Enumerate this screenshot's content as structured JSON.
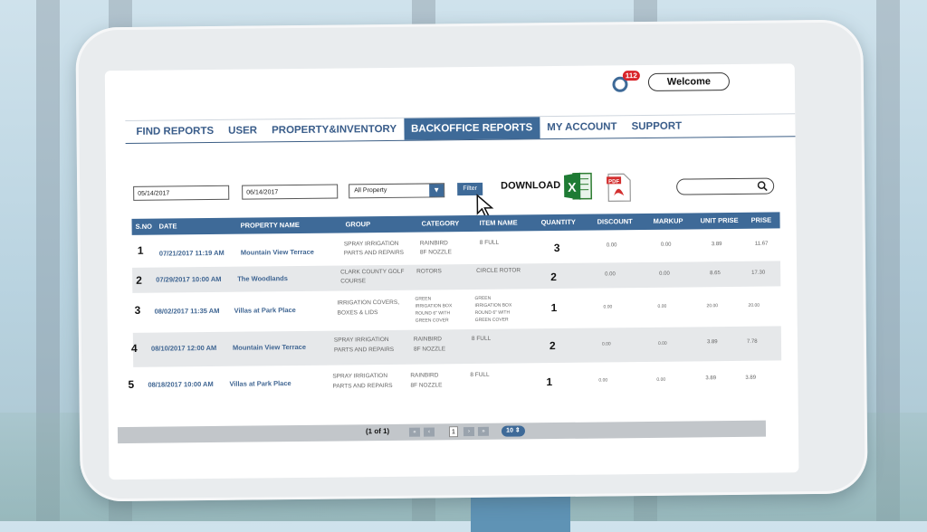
{
  "header": {
    "notification_count": "112",
    "welcome_label": "Welcome"
  },
  "nav": [
    {
      "label": "FIND REPORTS",
      "active": false
    },
    {
      "label": "USER",
      "active": false
    },
    {
      "label": "PROPERTY&INVENTORY",
      "active": false
    },
    {
      "label": "BACKOFFICE REPORTS",
      "active": true
    },
    {
      "label": "MY ACCOUNT",
      "active": false
    },
    {
      "label": "SUPPORT",
      "active": false
    }
  ],
  "filters": {
    "start_date": "05/14/2017",
    "end_date": "06/14/2017",
    "property_select": "All Property",
    "filter_label": "Filter",
    "download_label": "DOWNLOAD",
    "search_value": ""
  },
  "table": {
    "headers": [
      "S.NO",
      "DATE",
      "PROPERTY NAME",
      "GROUP",
      "CATEGORY",
      "ITEM NAME",
      "QUANTITY",
      "DISCOUNT",
      "MARKUP",
      "UNIT PRISE",
      "PRISE"
    ],
    "rows": [
      {
        "sno": "1",
        "date": "07/21/2017 11:19 AM",
        "property": "Mountain View Terrace",
        "group1": "SPRAY IRRIGATION",
        "group2": "PARTS AND REPAIRS",
        "cat1": "RAINBIRD",
        "cat2": "8F NOZZLE",
        "item1": "8 FULL",
        "item2": "",
        "qty": "3",
        "discount": "0.00",
        "markup": "0.00",
        "unit": "3.89",
        "price": "11.67"
      },
      {
        "sno": "2",
        "date": "07/29/2017 10:00 AM",
        "property": "The Woodlands",
        "group1": "CLARK COUNTY GOLF",
        "group2": "COURSE",
        "cat1": "ROTORS",
        "cat2": "",
        "item1": "CIRCLE ROTOR",
        "item2": "",
        "qty": "2",
        "discount": "0.00",
        "markup": "0.00",
        "unit": "8.65",
        "price": "17.30"
      },
      {
        "sno": "3",
        "date": "08/02/2017 11:35 AM",
        "property": "Villas at Park Place",
        "group1": "IRRIGATION COVERS,",
        "group2": "BOXES & LIDS",
        "cat_lines": [
          "GREEN",
          "IRRIGATION BOX",
          "ROUND 6\" WITH",
          "GREEN COVER"
        ],
        "item_lines": [
          "GREEN",
          "IRRIGATION BOX",
          "ROUND 6\" WITH",
          "GREEN COVER"
        ],
        "qty": "1",
        "discount": "0.00",
        "markup": "0.00",
        "unit": "20.00",
        "price": "20.00"
      },
      {
        "sno": "4",
        "date": "08/10/2017 12:00 AM",
        "property": "Mountain View Terrace",
        "group1": "SPRAY IRRIGATION",
        "group2": "PARTS AND REPAIRS",
        "cat1": "RAINBIRD",
        "cat2": "8F NOZZLE",
        "item1": "8 FULL",
        "item2": "",
        "qty": "2",
        "discount": "0.00",
        "markup": "0.00",
        "unit": "3.89",
        "price": "7.78"
      },
      {
        "sno": "5",
        "date": "08/18/2017 10:00 AM",
        "property": "Villas at Park Place",
        "group1": "SPRAY IRRIGATION",
        "group2": "PARTS AND REPAIRS",
        "cat1": "RAINBIRD",
        "cat2": "8F NOZZLE",
        "item1": "8 FULL",
        "item2": "",
        "qty": "1",
        "discount": "0.00",
        "markup": "0.00",
        "unit": "3.89",
        "price": "3.89"
      }
    ]
  },
  "pager": {
    "page_text": "(1 of 1)",
    "current_page": "1",
    "page_size": "10 ⇕"
  },
  "colors": {
    "primary": "#3e6a98",
    "badge": "#d9242a",
    "alt_row": "#e6e8ea"
  }
}
